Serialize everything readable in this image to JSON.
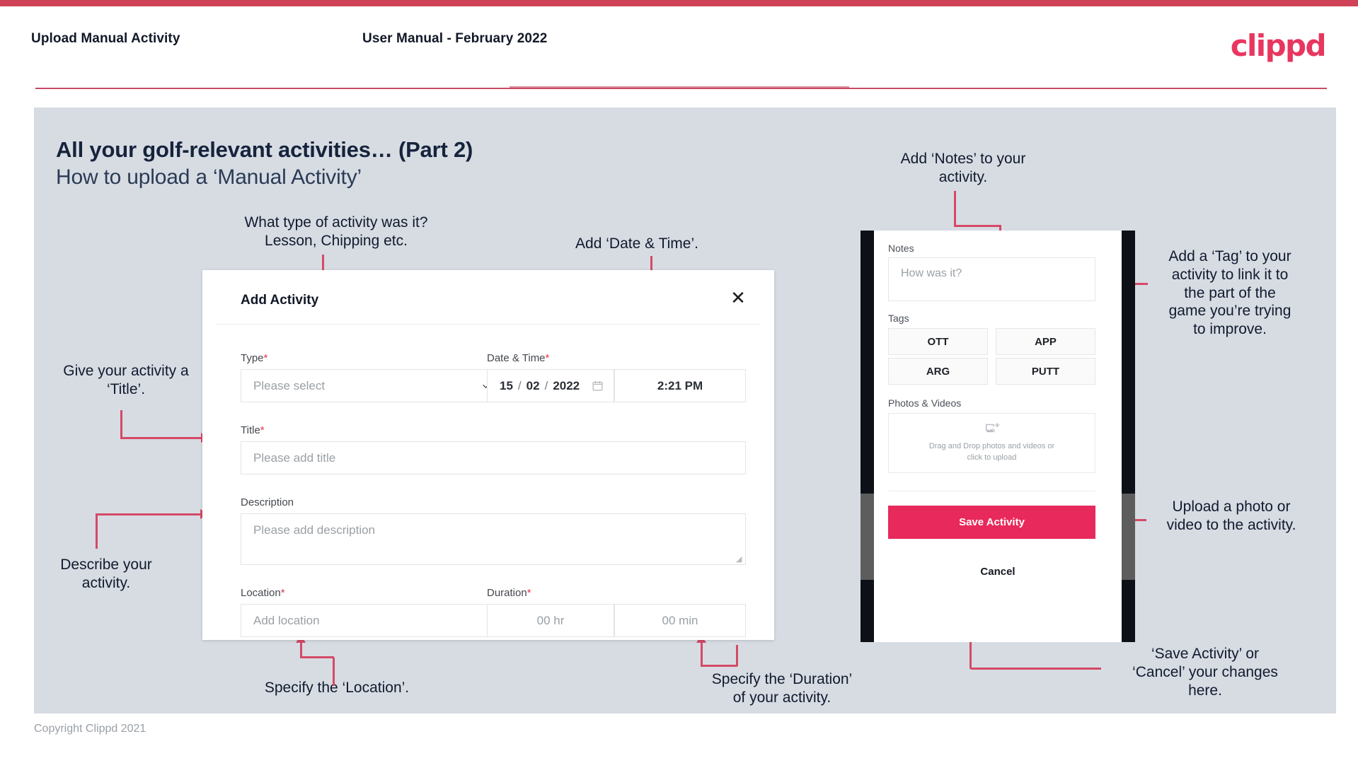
{
  "header": {
    "left_title": "Upload Manual Activity",
    "center_title": "User Manual - February 2022",
    "logo": "clippd"
  },
  "slide": {
    "title_line1": "All your golf-relevant activities… (Part 2)",
    "title_line2": "How to upload a ‘Manual Activity’"
  },
  "dialog": {
    "title": "Add Activity",
    "close_icon": "close-icon",
    "fields": {
      "type": {
        "label": "Type",
        "required": "*",
        "placeholder": "Please select",
        "caret_icon": "chevron-down-icon"
      },
      "datetime": {
        "label": "Date & Time",
        "required": "*",
        "day": "15",
        "sep1": "/",
        "month": "02",
        "sep2": "/",
        "year": "2022",
        "calendar_icon": "calendar-icon",
        "time": "2:21 PM"
      },
      "title": {
        "label": "Title",
        "required": "*",
        "placeholder": "Please add title"
      },
      "description": {
        "label": "Description",
        "required": "",
        "placeholder": "Please add description"
      },
      "location": {
        "label": "Location",
        "required": "*",
        "placeholder": "Add location"
      },
      "duration": {
        "label": "Duration",
        "required": "*",
        "hours_placeholder": "00 hr",
        "minutes_placeholder": "00 min"
      }
    }
  },
  "phone": {
    "notes": {
      "label": "Notes",
      "placeholder": "How was it?"
    },
    "tags": {
      "label": "Tags",
      "items": [
        "OTT",
        "APP",
        "ARG",
        "PUTT"
      ]
    },
    "photos": {
      "label": "Photos & Videos",
      "icon": "add-image-icon",
      "drop_line1": "Drag and Drop photos and videos or",
      "drop_line2": "click to upload"
    },
    "save_label": "Save Activity",
    "cancel_label": "Cancel"
  },
  "annotations": {
    "type": "What type of activity was it?\nLesson, Chipping etc.",
    "datetime": "Add ‘Date & Time’.",
    "title": "Give your activity a\n‘Title’.",
    "description": "Describe your\nactivity.",
    "location": "Specify the ‘Location’.",
    "duration": "Specify the ‘Duration’\nof your activity.",
    "notes": "Add ‘Notes’ to your\nactivity.",
    "tags": "Add a ‘Tag’ to your\nactivity to link it to\nthe part of the\ngame you’re trying\nto improve.",
    "upload": "Upload a photo or\nvideo to the activity.",
    "save": "‘Save Activity’ or\n‘Cancel’ your changes\nhere."
  },
  "footer": {
    "copyright": "Copyright Clippd 2021"
  },
  "colors": {
    "brand_pink": "#e8365f",
    "accent_line": "#d44a66",
    "save_button": "#e8295b",
    "slide_bg": "#d7dce3",
    "title_dark": "#16233c",
    "required_star": "#e0354f"
  }
}
